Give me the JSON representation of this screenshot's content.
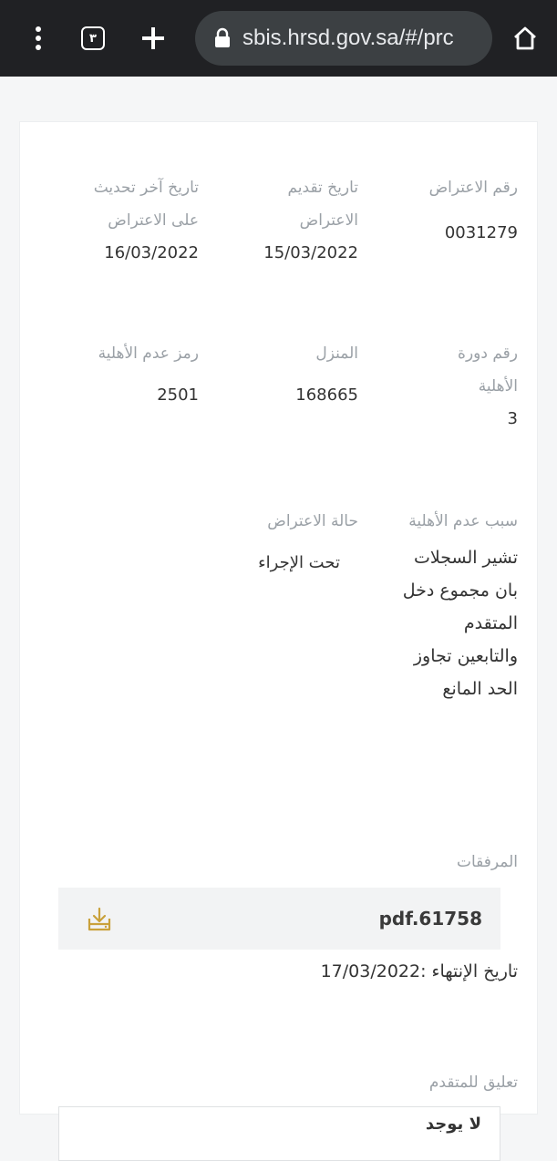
{
  "browser": {
    "tab_count": "٣",
    "url": "sbis.hrsd.gov.sa/#/prc"
  },
  "details": {
    "objection_number": {
      "label": "رقم الاعتراض",
      "value": "0031279"
    },
    "submission_date": {
      "label": "تاريخ تقديم الاعتراض",
      "value": "15/03/2022"
    },
    "last_update_date": {
      "label": "تاريخ آخر تحديث على الاعتراض",
      "value": "16/03/2022"
    },
    "eligibility_cycle": {
      "label": "رقم دورة الأهلية",
      "value": "3"
    },
    "household": {
      "label": "المنزل",
      "value": "168665"
    },
    "ineligibility_code": {
      "label": "رمز عدم الأهلية",
      "value": "2501"
    },
    "ineligibility_reason": {
      "label": "سبب عدم الأهلية",
      "value": "تشير السجلات بان مجموع دخل المتقدم والتابعين تجاوز الحد المانع"
    },
    "objection_status": {
      "label": "حالة الاعتراض",
      "value": "تحت الإجراء"
    }
  },
  "attachments": {
    "label": "المرفقات",
    "file_name": "pdf.61758",
    "expiry": "تاريخ الإنتهاء :17/03/2022"
  },
  "comment": {
    "label": "تعليق للمتقدم",
    "text": "لا يوجد"
  }
}
